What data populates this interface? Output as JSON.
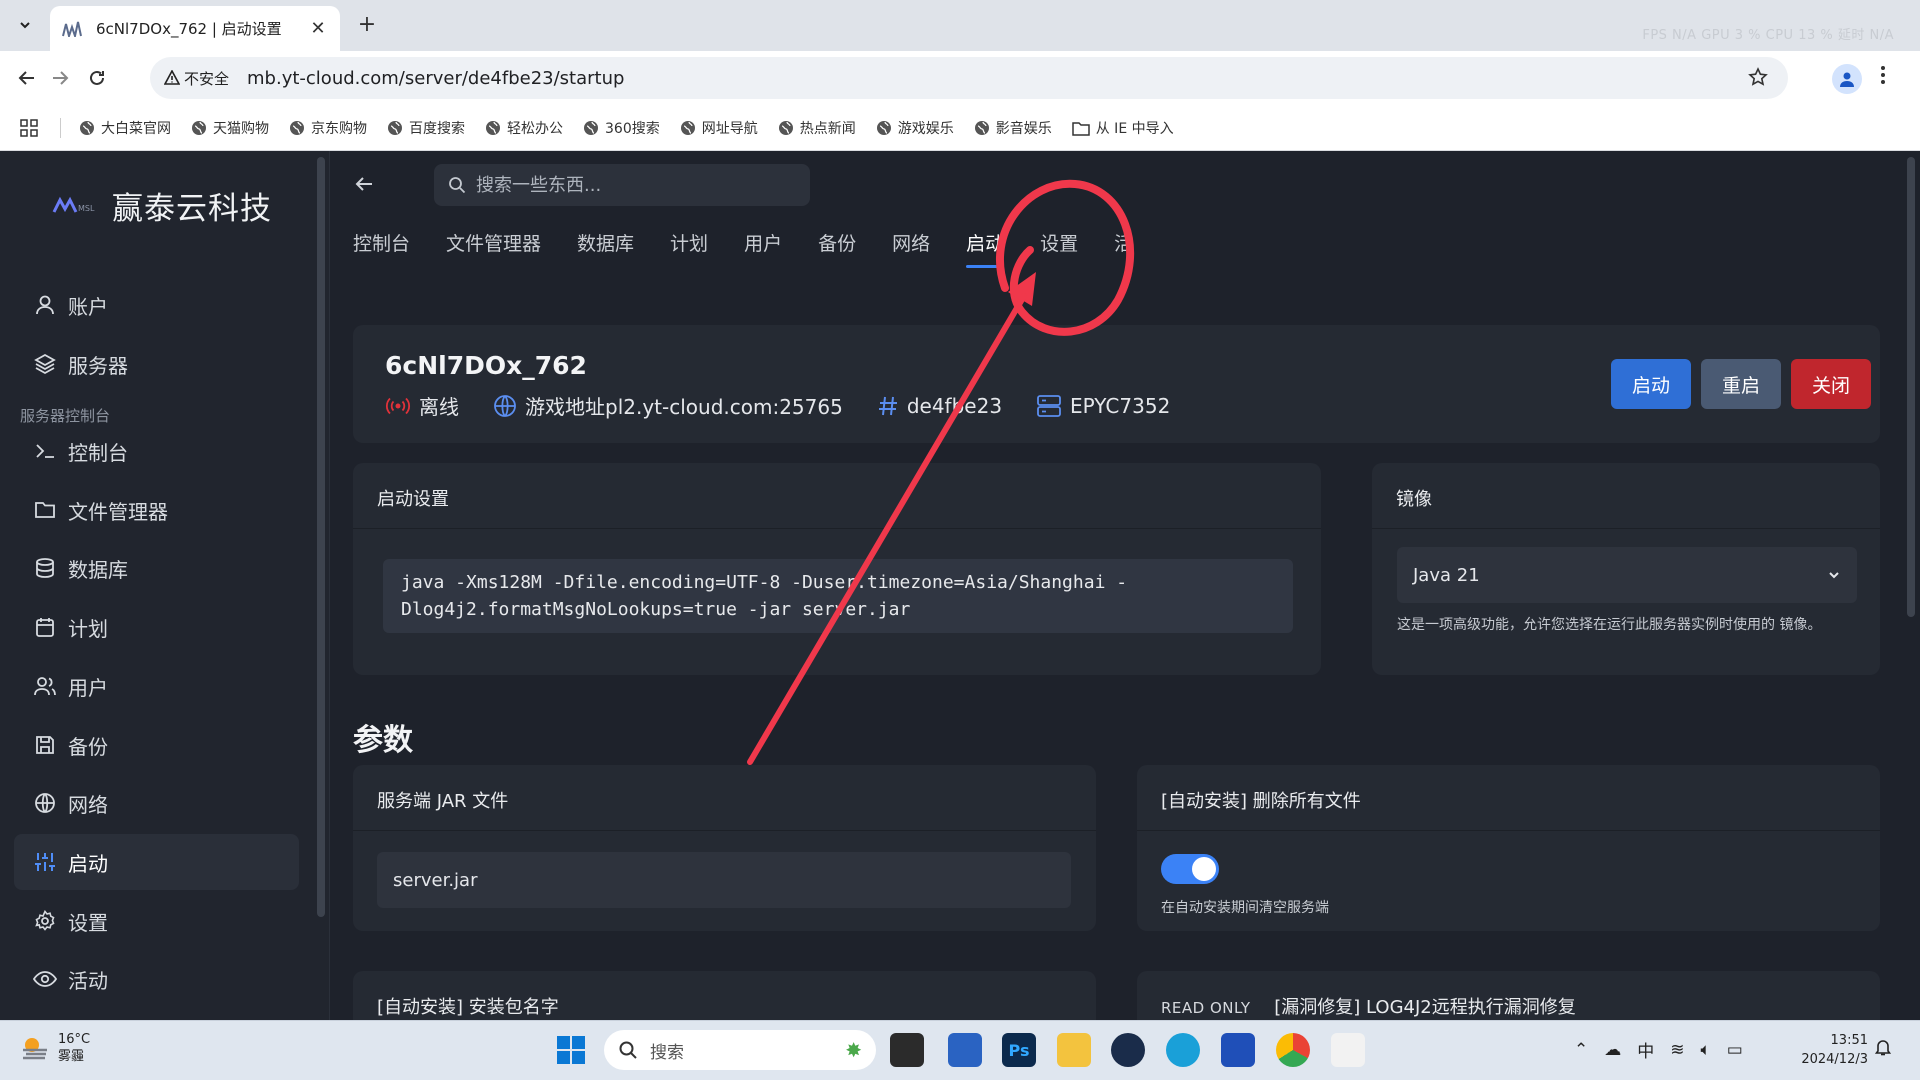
{
  "browser": {
    "tab_title": "6cNl7DOx_762 | 启动设置",
    "perf_text": "FPS  N/A  GPU   3 %   CPU   13 %  延时   N/A",
    "security_label": "不安全",
    "url": "mb.yt-cloud.com/server/de4fbe23/startup",
    "bookmarks": [
      "大白菜官网",
      "天猫购物",
      "京东购物",
      "百度搜索",
      "轻松办公",
      "360搜索",
      "网址导航",
      "热点新闻",
      "游戏娱乐",
      "影音娱乐"
    ],
    "import_label": "从 IE 中导入"
  },
  "sidebar": {
    "brand": "赢泰云科技",
    "top_items": [
      {
        "label": "账户",
        "icon": "user-icon"
      },
      {
        "label": "服务器",
        "icon": "layers-icon"
      }
    ],
    "section_label": "服务器控制台",
    "items": [
      {
        "label": "控制台",
        "icon": "terminal-icon"
      },
      {
        "label": "文件管理器",
        "icon": "folder-icon"
      },
      {
        "label": "数据库",
        "icon": "database-icon"
      },
      {
        "label": "计划",
        "icon": "calendar-icon"
      },
      {
        "label": "用户",
        "icon": "users-icon"
      },
      {
        "label": "备份",
        "icon": "save-icon"
      },
      {
        "label": "网络",
        "icon": "globe-icon"
      },
      {
        "label": "启动",
        "icon": "sliders-icon"
      },
      {
        "label": "设置",
        "icon": "gear-icon"
      },
      {
        "label": "活动",
        "icon": "eye-icon"
      }
    ],
    "active": "启动"
  },
  "header": {
    "search_placeholder": "搜索一些东西...",
    "tabs": [
      "控制台",
      "文件管理器",
      "数据库",
      "计划",
      "用户",
      "备份",
      "网络",
      "启动",
      "设置",
      "活动"
    ],
    "active_tab": "启动"
  },
  "server": {
    "name": "6cNl7DOx_762",
    "status": "离线",
    "address": "游戏地址pl2.yt-cloud.com:25765",
    "id": "de4fbe23",
    "cpu": "EPYC7352",
    "buttons": {
      "start": "启动",
      "restart": "重启",
      "stop": "关闭"
    },
    "colors": {
      "start": "#2f6fd6",
      "restart": "#4a5a73",
      "stop": "#c0262d",
      "offline": "#e0323a",
      "accent": "#3b82f6"
    }
  },
  "startup": {
    "title": "启动设置",
    "command_line1": "java -Xms128M -Dfile.encoding=UTF-8 -Duser.timezone=Asia/Shanghai -",
    "command_line2": "Dlog4j2.formatMsgNoLookups=true -jar server.jar"
  },
  "image": {
    "title": "镜像",
    "selected": "Java 21",
    "description": "这是一项高级功能，允许您选择在运行此服务器实例时使用的 镜像。"
  },
  "params": {
    "title": "参数",
    "jar": {
      "label": "服务端 JAR 文件",
      "value": "server.jar"
    },
    "delete_files": {
      "label": "[自动安装] 删除所有文件",
      "enabled": true,
      "description": "在自动安装期间清空服务端"
    },
    "package_name": {
      "label": "[自动安装] 安装包名字"
    },
    "log4j": {
      "badge": "READ ONLY",
      "label": "[漏洞修复] LOG4J2远程执行漏洞修复"
    }
  },
  "taskbar": {
    "temp": "16°C",
    "weather": "雾霾",
    "search": "搜索",
    "ime": "中",
    "time": "13:51",
    "date": "2024/12/3"
  }
}
